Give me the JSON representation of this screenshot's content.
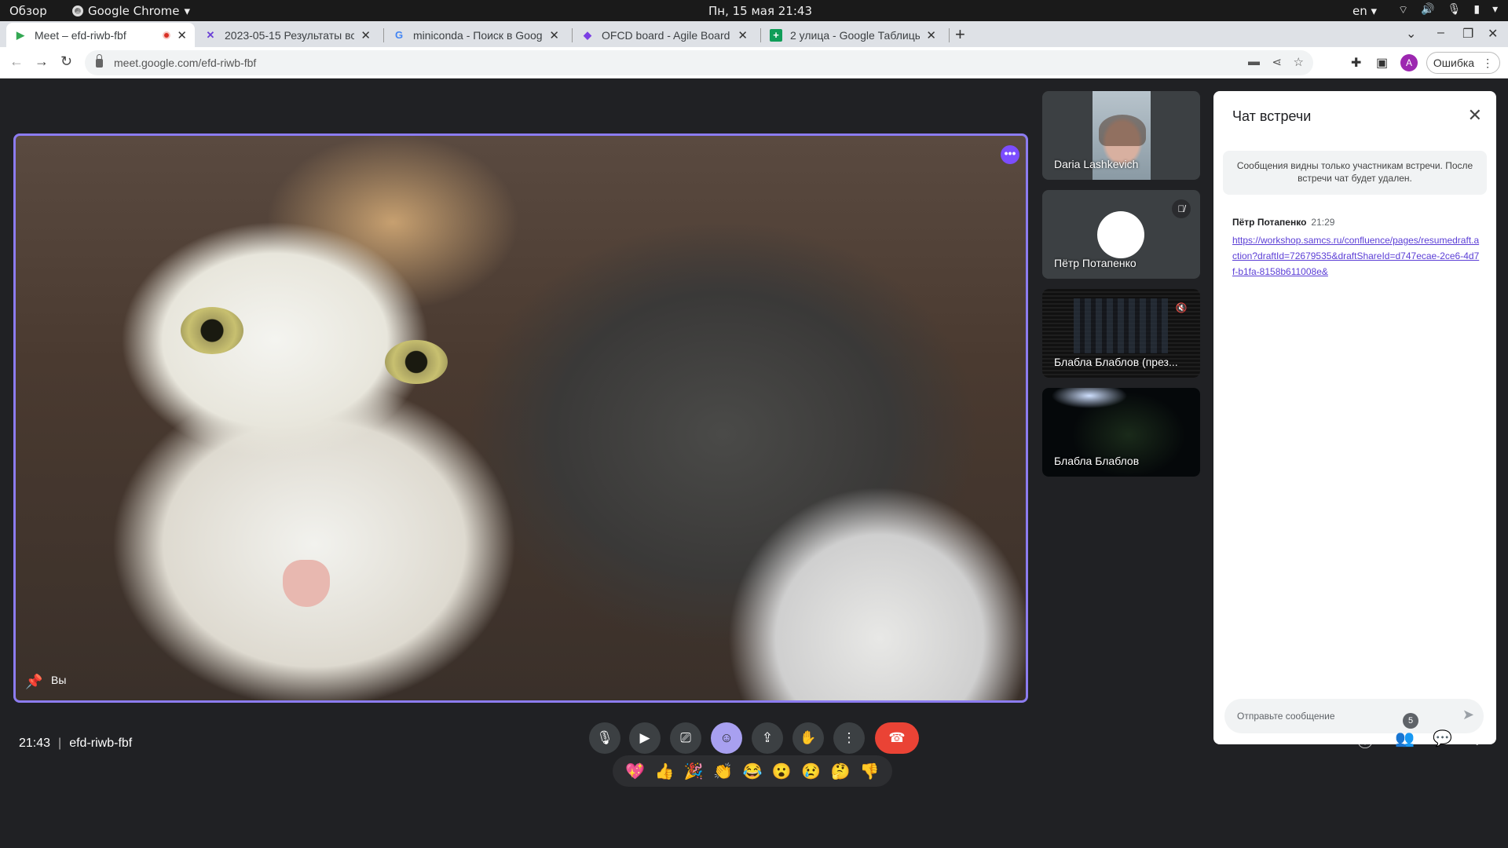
{
  "os": {
    "overview": "Обзор",
    "app": "Google Chrome",
    "clock": "Пн, 15 мая  21:43",
    "lang": "en"
  },
  "tabs": [
    {
      "title": "Meet – efd-riwb-fbf",
      "icon": "meet-icon"
    },
    {
      "title": "2023-05-15 Результаты вс",
      "icon": "confluence-icon"
    },
    {
      "title": "miniconda - Поиск в Goog",
      "icon": "google-icon"
    },
    {
      "title": "OFCD board - Agile Board",
      "icon": "agile-icon"
    },
    {
      "title": "2 улица - Google Таблицы",
      "icon": "sheets-icon"
    }
  ],
  "address": {
    "url": "meet.google.com/efd-riwb-fbf",
    "profile_initial": "A",
    "error_label": "Ошибка"
  },
  "main_video": {
    "label": "Вы"
  },
  "participants": [
    {
      "name": "Daria Lashkevich"
    },
    {
      "name": "Пётр Потапенко"
    },
    {
      "name": "Блабла Блаблов (през..."
    },
    {
      "name": "Блабла Блаблов"
    }
  ],
  "chat": {
    "title": "Чат встречи",
    "note": "Сообщения видны только участникам встречи. После встречи чат будет удален.",
    "messages": [
      {
        "sender": "Пётр Потапенко",
        "time": "21:29",
        "text": "https://workshop.samcs.ru/confluence/pages/resumedraft.action?draftId=72679535&draftShareId=d747ecae-2ce6-4d7f-b1fa-8158b611008e&"
      }
    ],
    "input_placeholder": "Отправьте сообщение"
  },
  "reactions": [
    "💖",
    "👍",
    "🎉",
    "👏",
    "😂",
    "😮",
    "😢",
    "🤔",
    "👎"
  ],
  "bottom": {
    "time": "21:43",
    "meeting_code": "efd-riwb-fbf",
    "participant_count": "5"
  },
  "colors": {
    "accent": "#8c7cf0",
    "end_call": "#ea4335",
    "link": "#5b3ed6"
  }
}
